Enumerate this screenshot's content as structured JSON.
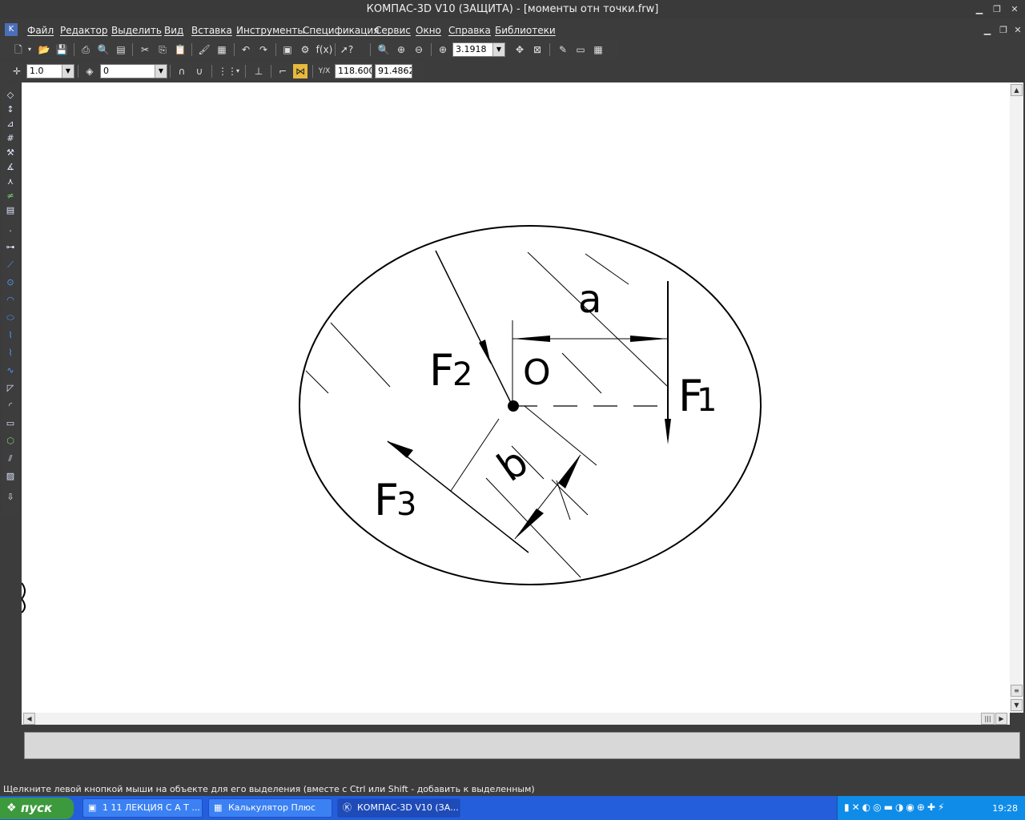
{
  "window": {
    "title": "КОМПАС-3D V10 (ЗАЩИТА) - [моменты отн точки.frw]"
  },
  "menu": [
    "Файл",
    "Редактор",
    "Выделить",
    "Вид",
    "Вставка",
    "Инструменты",
    "Спецификация",
    "Сервис",
    "Окно",
    "Справка",
    "Библиотеки"
  ],
  "toolbar1": {
    "zoom_value": "3.1918",
    "fx_label": "f(x)"
  },
  "toolbar2": {
    "step_value": "1.0",
    "layer_value": "0",
    "coord_x": "118.600",
    "coord_y": "91.4862",
    "coord_label": "Y/X"
  },
  "drawing": {
    "labels": {
      "a": "a",
      "o": "O",
      "f1": "F",
      "f1_sub": "1",
      "f2": "F",
      "f2_sub": "2",
      "f3": "F",
      "f3_sub": "3",
      "b": "b"
    }
  },
  "status": {
    "hint": "Щелкните левой кнопкой мыши на объекте для его выделения (вместе с Ctrl или Shift - добавить к выделенным)"
  },
  "taskbar": {
    "start_label": "пуск",
    "tasks": [
      "1 11 ЛЕКЦИЯ С А Т ...",
      "Калькулятор Плюс",
      "КОМПАС-3D V10 (ЗА..."
    ],
    "clock": "19:28"
  },
  "colors": {
    "chrome": "#3c3c3c",
    "taskbar": "#245edb",
    "start": "#3c9a3c",
    "canvas": "#ffffff"
  }
}
